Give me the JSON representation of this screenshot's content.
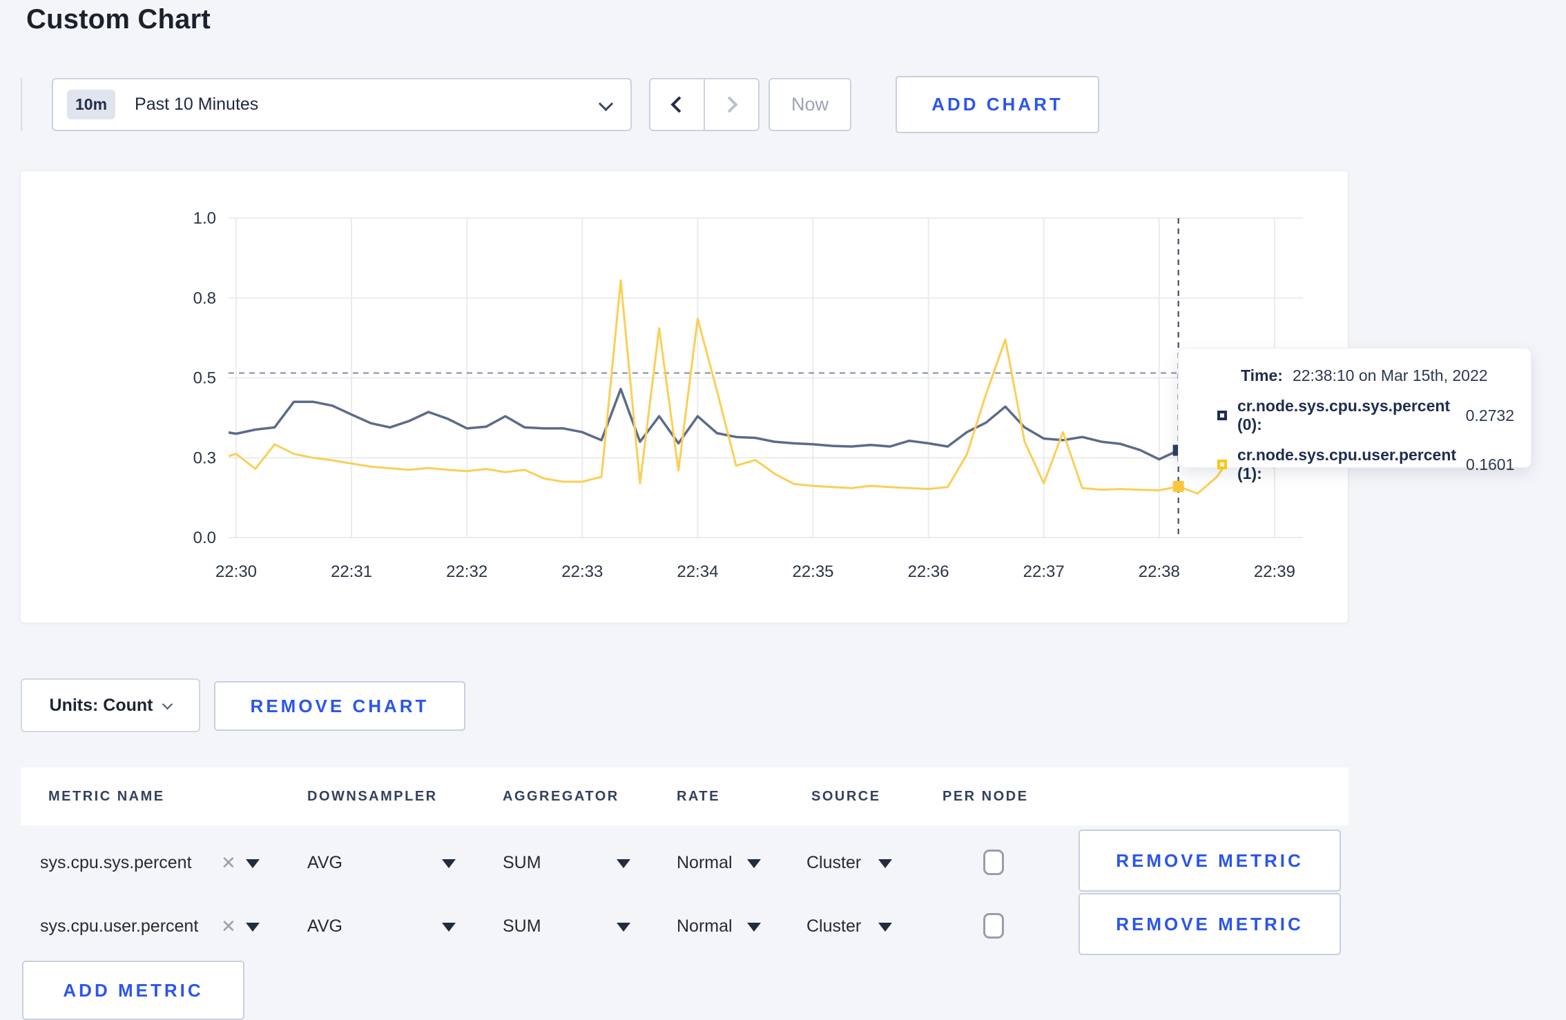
{
  "page": {
    "title": "Custom Chart"
  },
  "toolbar": {
    "time_badge": "10m",
    "time_label": "Past 10 Minutes",
    "now": "Now",
    "add_chart": "ADD CHART"
  },
  "units_row": {
    "units": "Units: Count",
    "remove_chart": "REMOVE CHART"
  },
  "metrics_table": {
    "headers": [
      "METRIC NAME",
      "DOWNSAMPLER",
      "AGGREGATOR",
      "RATE",
      "SOURCE",
      "PER NODE"
    ],
    "rows": [
      {
        "metric": "sys.cpu.sys.percent",
        "downsampler": "AVG",
        "aggregator": "SUM",
        "rate": "Normal",
        "source": "Cluster",
        "per_node_checked": false,
        "remove": "REMOVE METRIC"
      },
      {
        "metric": "sys.cpu.user.percent",
        "downsampler": "AVG",
        "aggregator": "SUM",
        "rate": "Normal",
        "source": "Cluster",
        "per_node_checked": false,
        "remove": "REMOVE METRIC"
      }
    ],
    "add_metric": "ADD METRIC"
  },
  "chart_data": {
    "type": "line",
    "title": "",
    "xlabel": "",
    "ylabel": "",
    "ylim": [
      0,
      1
    ],
    "grid": true,
    "x_unit": "seconds after 22:30:00",
    "start_seconds": -10,
    "step_seconds": 10,
    "x_ticks": [
      {
        "t": 0,
        "label": "22:30"
      },
      {
        "t": 60,
        "label": "22:31"
      },
      {
        "t": 120,
        "label": "22:32"
      },
      {
        "t": 180,
        "label": "22:33"
      },
      {
        "t": 240,
        "label": "22:34"
      },
      {
        "t": 300,
        "label": "22:35"
      },
      {
        "t": 360,
        "label": "22:36"
      },
      {
        "t": 420,
        "label": "22:37"
      },
      {
        "t": 480,
        "label": "22:38"
      },
      {
        "t": 540,
        "label": "22:39"
      }
    ],
    "y_ticks": [
      {
        "v": 0,
        "label": "0.0"
      },
      {
        "v": 0.25,
        "label": "0.3"
      },
      {
        "v": 0.5,
        "label": "0.5"
      },
      {
        "v": 0.75,
        "label": "0.8"
      },
      {
        "v": 1.0,
        "label": "1.0"
      }
    ],
    "series": [
      {
        "name": "cr.node.sys.cpu.sys.percent",
        "color": "#5b6b89",
        "marker_color": "#2e3c5c",
        "stroke_width": 3.5,
        "values": [
          0.335,
          0.325,
          0.338,
          0.345,
          0.425,
          0.425,
          0.413,
          0.385,
          0.358,
          0.345,
          0.365,
          0.393,
          0.372,
          0.342,
          0.347,
          0.38,
          0.345,
          0.342,
          0.342,
          0.33,
          0.305,
          0.465,
          0.3,
          0.38,
          0.295,
          0.38,
          0.327,
          0.315,
          0.312,
          0.3,
          0.295,
          0.292,
          0.287,
          0.285,
          0.29,
          0.285,
          0.303,
          0.295,
          0.285,
          0.33,
          0.36,
          0.41,
          0.345,
          0.31,
          0.305,
          0.315,
          0.3,
          0.293,
          0.274,
          0.245,
          0.2732,
          0.238,
          0.242,
          0.25,
          0.252,
          0.262,
          0.285
        ]
      },
      {
        "name": "cr.node.sys.cpu.user.percent",
        "color": "#fbcf55",
        "marker_color": "#fdc63d",
        "stroke_width": 3,
        "values": [
          0.245,
          0.262,
          0.215,
          0.292,
          0.262,
          0.25,
          0.242,
          0.232,
          0.222,
          0.217,
          0.212,
          0.218,
          0.212,
          0.208,
          0.215,
          0.205,
          0.212,
          0.185,
          0.175,
          0.175,
          0.19,
          0.805,
          0.17,
          0.655,
          0.21,
          0.685,
          0.46,
          0.225,
          0.243,
          0.2,
          0.168,
          0.162,
          0.158,
          0.155,
          0.162,
          0.158,
          0.155,
          0.152,
          0.158,
          0.26,
          0.45,
          0.62,
          0.3,
          0.17,
          0.33,
          0.155,
          0.15,
          0.152,
          0.15,
          0.148,
          0.1601,
          0.138,
          0.19,
          0.28,
          0.225,
          0.22,
          0.262
        ]
      }
    ],
    "crosshair": {
      "t_seconds": 490,
      "point_index": 50,
      "hline_value": 0.515,
      "vline_color": "#3f4e68",
      "hline_color": "#7d8ea8"
    },
    "tooltip": {
      "time_label": "Time:",
      "time_value": "22:38:10 on Mar 15th, 2022",
      "rows": [
        {
          "name": "cr.node.sys.cpu.sys.percent (0):",
          "value": "0.2732",
          "color": "#1d2d4f"
        },
        {
          "name": "cr.node.sys.cpu.user.percent (1):",
          "value": "0.1601",
          "color": "#ffc50f"
        }
      ]
    },
    "legend_position": "tooltip-only",
    "axis_label_color": "#2b3447",
    "gridline_color": "#e9e9e9"
  }
}
